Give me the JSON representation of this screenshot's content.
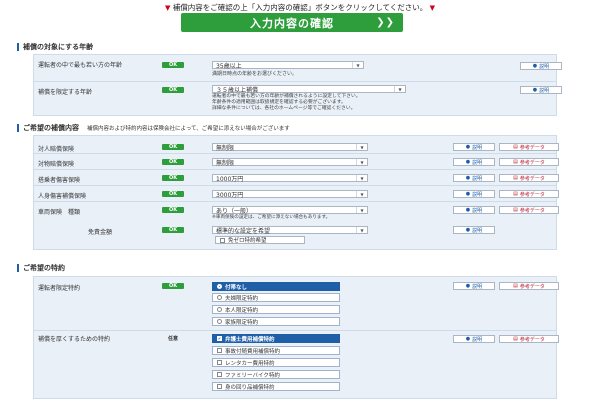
{
  "notice": "補償内容をご確認の上「入力内容の確認」ボタンをクリックしてください。",
  "confirm_button": "入力内容の確認",
  "section1": {
    "title": "補償の対象にする年齢",
    "rows": [
      {
        "label": "運転者の中で最も若い方の年齢",
        "status": "OK",
        "value": "35歳以上",
        "sub": "満期日時点の年齢をお選びください。",
        "help": "説明"
      },
      {
        "label": "補償を限定する年齢",
        "status": "OK",
        "value": "３５歳以上補償",
        "sub": [
          "運転者の中で最も若い方の年齢が補償されるように設定して下さい。",
          "年齢条件の適用範囲は取扱規定を確認する必要がございます。",
          "詳細な条件については、各社のホームページ等でご確認ください。"
        ],
        "help": "説明"
      }
    ]
  },
  "section2": {
    "title": "ご希望の補償内容",
    "note": "補償内容および特約内容は保険会社によって、ご希望に添えない場合がございます",
    "rows": [
      {
        "label": "対人賠償保険",
        "status": "OK",
        "value": "無制限",
        "help": "説明",
        "ref": "参考データ"
      },
      {
        "label": "対物賠償保険",
        "status": "OK",
        "value": "無制限",
        "help": "説明",
        "ref": "参考データ"
      },
      {
        "label": "搭乗者傷害保険",
        "status": "OK",
        "value": "1000万円",
        "help": "説明",
        "ref": "参考データ"
      },
      {
        "label": "人身傷害補償保険",
        "status": "OK",
        "value": "3000万円",
        "help": "説明",
        "ref": "参考データ"
      },
      {
        "label": "車両保険　種類",
        "status": "OK",
        "value": "あり（一般）",
        "sub": "※車両保険の設定は、ご希望に添えない場合もあります。",
        "help": "説明",
        "ref": "参考データ"
      },
      {
        "label": "免責金額",
        "status": "OK",
        "value": "標準的な設定を希望",
        "checkbox": "免ゼロ特約希望",
        "help": "説明"
      }
    ]
  },
  "section3": {
    "title": "ご希望の特約",
    "rows": [
      {
        "label": "運転者限定特約",
        "status": "OK",
        "help": "説明",
        "ref": "参考データ",
        "options": [
          {
            "label": "付帯なし",
            "selected": true
          },
          {
            "label": "夫婦限定特約",
            "selected": false
          },
          {
            "label": "本人限定特約",
            "selected": false
          },
          {
            "label": "家族限定特約",
            "selected": false
          }
        ]
      },
      {
        "label": "補償を厚くするための特約",
        "status": "任意",
        "help": "説明",
        "ref": "参考データ",
        "options": [
          {
            "label": "弁護士費用補償特約",
            "selected": true
          },
          {
            "label": "事故付随費用補償特約",
            "selected": false
          },
          {
            "label": "レンタカー費用特約",
            "selected": false
          },
          {
            "label": "ファミリーバイク特約",
            "selected": false
          },
          {
            "label": "身の回り品補償特約",
            "selected": false
          }
        ]
      }
    ]
  },
  "colors": {
    "accent_green": "#2e9e3c",
    "accent_blue": "#1f5fa8",
    "panel_bg": "#e9f0f8"
  }
}
